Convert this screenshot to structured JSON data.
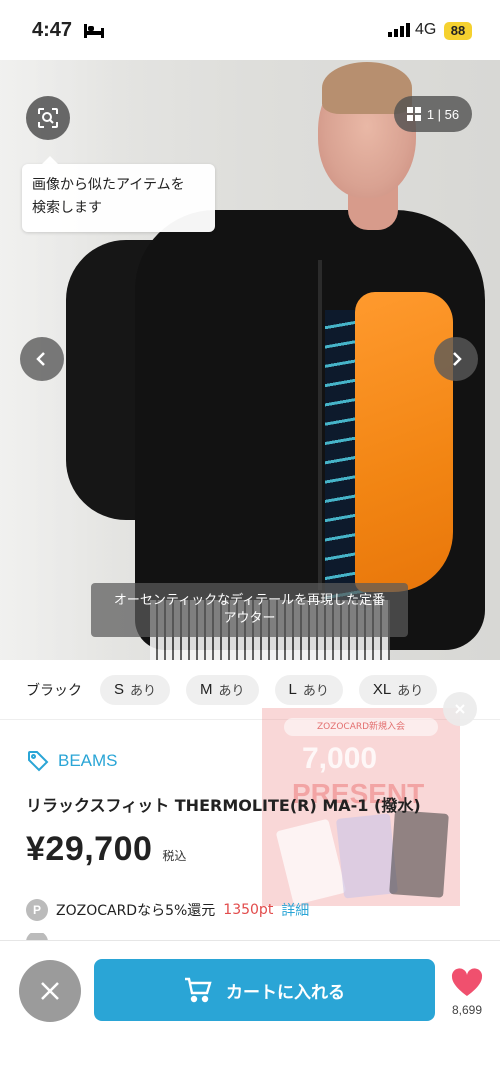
{
  "status_bar": {
    "time": "4:47",
    "network": "4G",
    "battery": "88"
  },
  "gallery": {
    "counter": "1 | 56",
    "tooltip_line1": "画像から似たアイテムを",
    "tooltip_line2": "検索します",
    "caption_line1": "オーセンティックなディテールを再現した定番",
    "caption_line2": "アウター"
  },
  "variants": {
    "color": "ブラック",
    "sizes": [
      {
        "size": "S",
        "stock": "あり"
      },
      {
        "size": "M",
        "stock": "あり"
      },
      {
        "size": "L",
        "stock": "あり"
      },
      {
        "size": "XL",
        "stock": "あり"
      }
    ]
  },
  "promo_ad": {
    "top_text": "ZOZOCARD新規入会",
    "amount": "7,000",
    "word": "PRESENT"
  },
  "product": {
    "brand": "BEAMS",
    "title": "リラックスフィット THERMOLITE(R) MA-1 (撥水)",
    "price": "¥29,700",
    "tax_label": "税込"
  },
  "points": {
    "badge": "P",
    "text": "ZOZOCARDなら5%還元",
    "value": "1350pt",
    "detail_link": "詳細"
  },
  "bottom_bar": {
    "cart_label": "カートに入れる",
    "favorite_count": "8,699"
  },
  "colors": {
    "accent": "#2aa5d6",
    "points_red": "#e24b4b",
    "favorite": "#f0506e"
  }
}
